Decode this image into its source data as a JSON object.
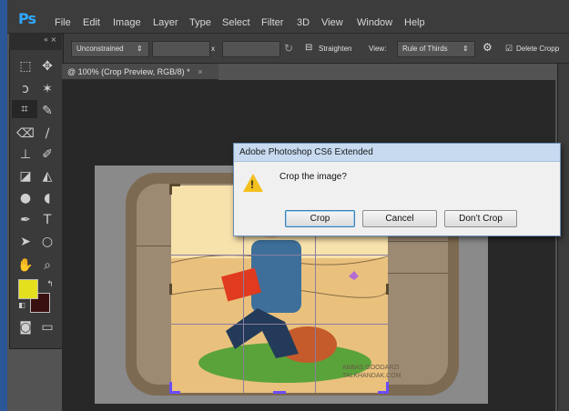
{
  "app": {
    "logo": "Ps"
  },
  "menu": [
    "File",
    "Edit",
    "Image",
    "Layer",
    "Type",
    "Select",
    "Filter",
    "3D",
    "View",
    "Window",
    "Help"
  ],
  "options_bar": {
    "ratio": "Unconstrained",
    "times": "x",
    "straighten": "Straighten",
    "view_label": "View:",
    "view_value": "Rule of Thirds",
    "delete_label": "Delete Cropp"
  },
  "document_tab": {
    "title": "@ 100% (Crop Preview, RGB/8) *",
    "close": "×"
  },
  "dialog": {
    "title": "Adobe Photoshop CS6 Extended",
    "message": "Crop the image?",
    "warn": "!",
    "buttons": {
      "crop": "Crop",
      "cancel": "Cancel",
      "dont_crop": "Don’t Crop"
    }
  },
  "canvas": {
    "watermark": "ABBAS GOODARZI\nTALKHANDAK.COM"
  },
  "colors": {
    "foreground": "#e4e01e",
    "background": "#3a0f0f",
    "ps_blue": "#31a8ff"
  }
}
